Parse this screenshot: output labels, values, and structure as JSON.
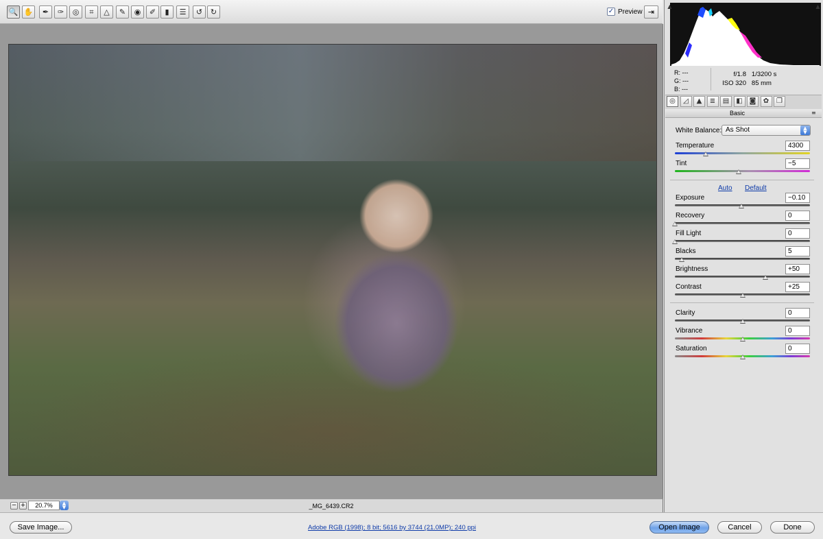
{
  "toolbar": {
    "tools": [
      {
        "icon": "zoom-icon",
        "glyph": "🔍",
        "active": true
      },
      {
        "icon": "hand-icon",
        "glyph": "✋"
      },
      {
        "icon": "white-balance-eyedropper-icon",
        "glyph": "✒"
      },
      {
        "icon": "color-sampler-icon",
        "glyph": "✑"
      },
      {
        "icon": "targeted-adjustment-icon",
        "glyph": "◎"
      },
      {
        "icon": "crop-icon",
        "glyph": "⌗"
      },
      {
        "icon": "straighten-icon",
        "glyph": "△"
      },
      {
        "icon": "spot-removal-icon",
        "glyph": "✎"
      },
      {
        "icon": "red-eye-icon",
        "glyph": "◉"
      },
      {
        "icon": "adjustment-brush-icon",
        "glyph": "✐"
      },
      {
        "icon": "graduated-filter-icon",
        "glyph": "▮"
      },
      {
        "icon": "preferences-icon",
        "glyph": "☰"
      },
      {
        "icon": "rotate-left-icon",
        "glyph": "↺"
      },
      {
        "icon": "rotate-right-icon",
        "glyph": "↻"
      }
    ],
    "preview_label": "Preview",
    "preview_checked": true,
    "fullscreen_icon": "fullscreen-toggle-icon"
  },
  "canvas": {
    "zoom_minus": "−",
    "zoom_plus": "+",
    "zoom_value": "20.7%",
    "filename": "_MG_6439.CR2"
  },
  "info": {
    "r_label": "R:",
    "r_value": "---",
    "g_label": "G:",
    "g_value": "---",
    "b_label": "B:",
    "b_value": "---",
    "aperture": "f/1.8",
    "shutter": "1/3200 s",
    "iso": "ISO 320",
    "focal": "85 mm"
  },
  "histogram": {
    "clip_shadow_icon": "shadow-clipping-warning-icon",
    "clip_highlight_icon": "highlight-clipping-warning-icon"
  },
  "panel": {
    "tabs": [
      "basic-icon",
      "tone-curve-icon",
      "detail-icon",
      "hsl-icon",
      "split-toning-icon",
      "lens-corrections-icon",
      "camera-calibration-icon",
      "presets-icon",
      "snapshots-icon"
    ],
    "title": "Basic",
    "white_balance_label": "White Balance:",
    "white_balance_value": "As Shot",
    "auto_label": "Auto",
    "default_label": "Default",
    "sliders": [
      {
        "name": "temperature",
        "label": "Temperature",
        "value": "4300",
        "pos": 0.23,
        "track": "temp"
      },
      {
        "name": "tint",
        "label": "Tint",
        "value": "−5",
        "pos": 0.47,
        "track": "tint"
      },
      {
        "name": "exposure",
        "label": "Exposure",
        "value": "−0.10",
        "pos": 0.49,
        "track": "gray"
      },
      {
        "name": "recovery",
        "label": "Recovery",
        "value": "0",
        "pos": 0.0,
        "track": "gray"
      },
      {
        "name": "fill-light",
        "label": "Fill Light",
        "value": "0",
        "pos": 0.0,
        "track": "gray"
      },
      {
        "name": "blacks",
        "label": "Blacks",
        "value": "5",
        "pos": 0.05,
        "track": "gray"
      },
      {
        "name": "brightness",
        "label": "Brightness",
        "value": "+50",
        "pos": 0.67,
        "track": "gray"
      },
      {
        "name": "contrast",
        "label": "Contrast",
        "value": "+25",
        "pos": 0.5,
        "track": "gray"
      },
      {
        "name": "clarity",
        "label": "Clarity",
        "value": "0",
        "pos": 0.5,
        "track": "gray"
      },
      {
        "name": "vibrance",
        "label": "Vibrance",
        "value": "0",
        "pos": 0.5,
        "track": "rainbow"
      },
      {
        "name": "saturation",
        "label": "Saturation",
        "value": "0",
        "pos": 0.5,
        "track": "rainbow"
      }
    ]
  },
  "footer": {
    "save_label": "Save Image...",
    "workflow_link": "Adobe RGB (1998); 8 bit; 5616 by 3744 (21.0MP); 240 ppi",
    "open_label": "Open Image",
    "cancel_label": "Cancel",
    "done_label": "Done"
  }
}
